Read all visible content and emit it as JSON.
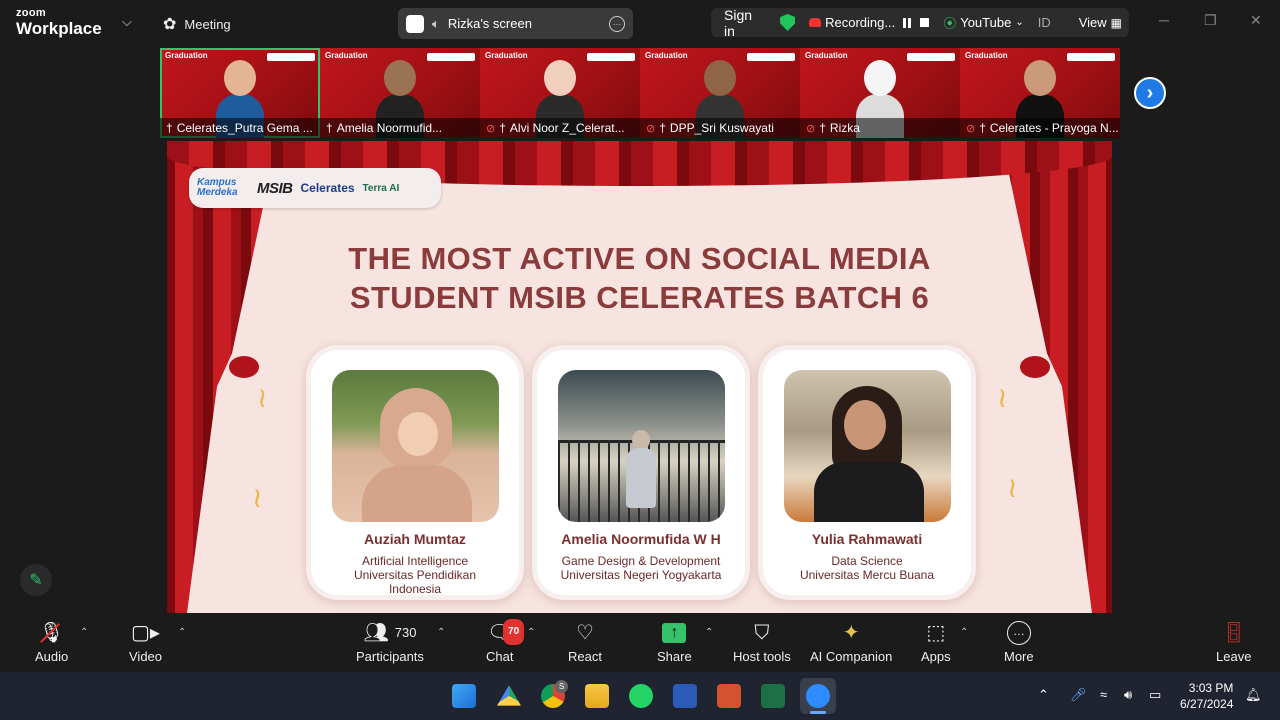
{
  "app": {
    "logo_top": "zoom",
    "logo_bottom": "Workplace",
    "meeting_label": "Meeting"
  },
  "share": {
    "label": "Rizka's screen"
  },
  "status": {
    "sign_in": "Sign in",
    "recording": "Recording...",
    "youtube": "YouTube",
    "id": "ID",
    "view": "View"
  },
  "participants_strip": [
    {
      "name": "Celerates_Putra Gema ...",
      "active": true,
      "muted": false
    },
    {
      "name": "Amelia Noormufid...",
      "active": false,
      "muted": false
    },
    {
      "name": "Alvi Noor Z_Celerat...",
      "active": false,
      "muted": true
    },
    {
      "name": "DPP_Sri Kuswayati",
      "active": false,
      "muted": true
    },
    {
      "name": "Rizka",
      "active": false,
      "muted": true
    },
    {
      "name": "Celerates - Prayoga N...",
      "active": false,
      "muted": true
    }
  ],
  "tile_text": {
    "graduation": "Graduation"
  },
  "slide": {
    "logos": {
      "kampus": "Kampus Merdeka",
      "msib": "MSIB",
      "celerates": "Celerates",
      "terra": "Terra AI"
    },
    "heading_line1": "THE MOST ACTIVE ON SOCIAL MEDIA",
    "heading_line2": "STUDENT MSIB CELERATES BATCH 6",
    "cards": [
      {
        "name": "Auziah Mumtaz",
        "line1": "Artificial Intelligence",
        "line2": "Universitas Pendidikan",
        "line3": "Indonesia"
      },
      {
        "name": "Amelia Noormufida W H",
        "line1": "Game Design & Development",
        "line2": "Universitas Negeri Yogyakarta",
        "line3": ""
      },
      {
        "name": "Yulia Rahmawati",
        "line1": "Data Science",
        "line2": "Universitas Mercu Buana",
        "line3": ""
      }
    ]
  },
  "toolbar": {
    "audio": "Audio",
    "video": "Video",
    "participants": "Participants",
    "participants_count": "730",
    "chat": "Chat",
    "chat_badge": "70",
    "react": "React",
    "share": "Share",
    "host_tools": "Host tools",
    "ai_companion": "AI Companion",
    "apps": "Apps",
    "more": "More",
    "leave": "Leave"
  },
  "taskbar": {
    "time": "3:03 PM",
    "date": "6/27/2024",
    "chrome_badge": "S"
  },
  "colors": {
    "accent_green": "#34c26b",
    "tile_red": "#c0161c",
    "heading": "#8a3b3b",
    "leave_red": "#e0322f"
  }
}
